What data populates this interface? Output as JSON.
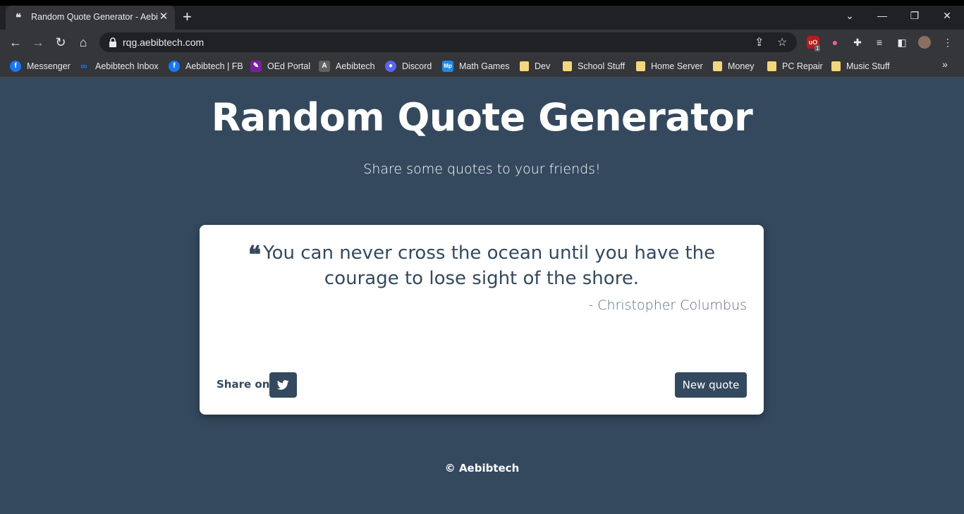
{
  "browser": {
    "tab": {
      "title": "Random Quote Generator - Aebibtech",
      "favicon": "quote-icon",
      "close_glyph": "✕"
    },
    "new_tab_glyph": "+",
    "url": "rqg.aebibtech.com",
    "bookmarks": [
      {
        "label": "Messenger",
        "icon": "facebook-icon"
      },
      {
        "label": "Aebibtech Inbox",
        "icon": "meta-icon"
      },
      {
        "label": "Aebibtech | FB",
        "icon": "facebook-icon"
      },
      {
        "label": "OEd Portal",
        "icon": "oed-icon"
      },
      {
        "label": "Aebibtech",
        "icon": "aebibtech-icon"
      },
      {
        "label": "Discord",
        "icon": "discord-icon"
      },
      {
        "label": "Math Games",
        "icon": "mathgames-icon"
      },
      {
        "label": "Dev",
        "icon": "folder-icon"
      },
      {
        "label": "School Stuff",
        "icon": "folder-icon"
      },
      {
        "label": "Home Server",
        "icon": "folder-icon"
      },
      {
        "label": "Money",
        "icon": "folder-icon"
      },
      {
        "label": "PC Repair",
        "icon": "folder-icon"
      },
      {
        "label": "Music Stuff",
        "icon": "folder-icon"
      }
    ],
    "ext_badge": "1"
  },
  "page": {
    "title": "Random Quote Generator",
    "subtitle": "Share some quotes to your friends!",
    "quote": {
      "text": "You can never cross the ocean until you have the courage to lose sight of the shore.",
      "author": "- Christopher Columbus"
    },
    "share_label": "Share on:",
    "new_quote_label": "New quote",
    "footer": "© Aebibtech"
  },
  "colors": {
    "background": "#34495e",
    "card": "#ffffff",
    "button": "#34495e"
  }
}
